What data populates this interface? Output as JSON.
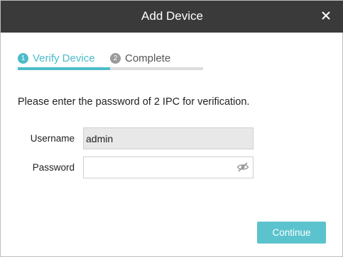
{
  "dialog": {
    "title": "Add Device",
    "close_icon": "close-icon"
  },
  "steps": [
    {
      "number": "1",
      "label": "Verify Device",
      "state": "active"
    },
    {
      "number": "2",
      "label": "Complete",
      "state": "pending"
    }
  ],
  "form": {
    "instruction": "Please enter the password of 2 IPC for verification.",
    "username_label": "Username",
    "username_value": "admin",
    "password_label": "Password",
    "password_value": "",
    "password_toggle_icon": "eye-slash-icon"
  },
  "actions": {
    "continue_label": "Continue"
  },
  "colors": {
    "accent": "#4bbcc9",
    "titlebar": "#3a3a3a",
    "button": "#5bc3cd"
  }
}
